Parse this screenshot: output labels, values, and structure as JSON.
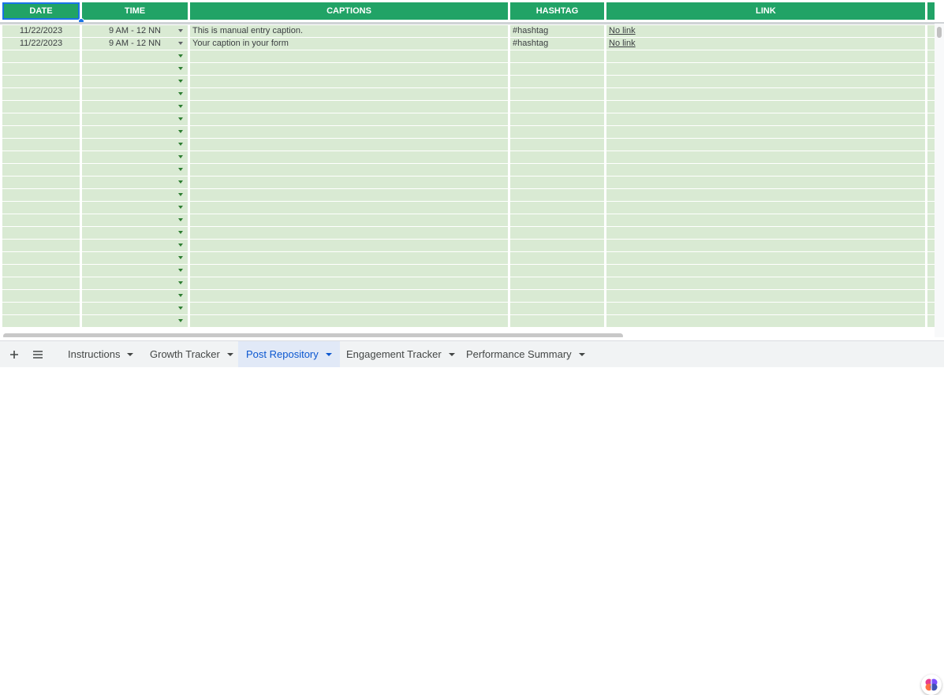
{
  "headers": {
    "date": "DATE",
    "time": "TIME",
    "captions": "CAPTIONS",
    "hashtag": "HASHTAG",
    "link": "LINK"
  },
  "rows": [
    {
      "date": "11/22/2023",
      "time": "9 AM - 12 NN",
      "caption": "This is manual entry caption.",
      "hashtag": "#hashtag",
      "link": "No link"
    },
    {
      "date": "11/22/2023",
      "time": "9 AM - 12 NN",
      "caption": "Your caption in your form",
      "hashtag": "#hashtag",
      "link": "No link"
    }
  ],
  "toolbar": {
    "add_icon": "plus-icon",
    "menu_icon": "hamburger-menu-icon"
  },
  "tabs": [
    {
      "label": "Instructions",
      "active": false
    },
    {
      "label": "Growth Tracker",
      "active": false
    },
    {
      "label": "Post Repository",
      "active": true
    },
    {
      "label": "Engagement Tracker",
      "active": false
    },
    {
      "label": "Performance Summary",
      "active": false
    }
  ],
  "colors": {
    "header": "#21a366",
    "row_fill": "#d9ead3",
    "selection": "#1a73e8",
    "active_tab": "#0b57d0"
  },
  "icons": {
    "assistant": "brain-ai-icon",
    "dropdown": "chevron-down-icon"
  }
}
